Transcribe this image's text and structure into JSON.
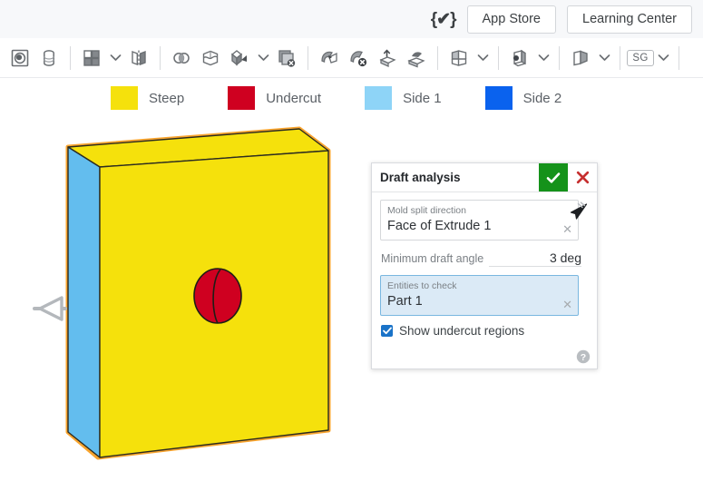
{
  "header": {
    "brace_icon": "{✔}",
    "buttons": [
      {
        "label": "App Store",
        "name": "app-store-button"
      },
      {
        "label": "Learning Center",
        "name": "learning-center-button"
      }
    ]
  },
  "toolbar": {
    "groups": [
      {
        "icons": [
          "sketch-icon",
          "cylinder-icon"
        ]
      },
      {
        "icons": [
          "pattern-icon"
        ],
        "caret": true
      },
      {
        "icons": [
          "mirror-icon"
        ]
      },
      {
        "icons": [
          "boolean-icon",
          "split-icon",
          "transform-icon"
        ],
        "caret_after": "transform-icon"
      },
      {
        "icons": [
          "delete-face-icon"
        ]
      },
      {
        "icons": [
          "draft-icon",
          "delete-part-icon",
          "move-face-icon",
          "shell-icon"
        ]
      },
      {
        "icons": [
          "section-view-icon"
        ],
        "caret": true
      },
      {
        "icons": [
          "measure-icon"
        ],
        "caret": true
      },
      {
        "icons": [
          "draft-analysis-icon"
        ],
        "caret": true
      },
      {
        "icons": [
          "sg-icon"
        ],
        "caret": true,
        "sg_label": "SG"
      }
    ]
  },
  "legend": {
    "items": [
      {
        "label": "Steep",
        "color": "#f5e10c",
        "name": "legend-steep"
      },
      {
        "label": "Undercut",
        "color": "#cf0020",
        "name": "legend-undercut"
      },
      {
        "label": "Side 1",
        "color": "#8ed4f7",
        "name": "legend-side-1"
      },
      {
        "label": "Side 2",
        "color": "#0a62ee",
        "name": "legend-side-2"
      }
    ]
  },
  "viewport": {
    "model": {
      "name": "draft-analysis-part",
      "front_face_color": "#f5e10c",
      "side_face_color": "#63bdee",
      "top_face_color": "#f5e10c",
      "hole_color": "#cf0020",
      "highlight_edge_color": "#f8a42e",
      "edge_color": "#2b2b20",
      "arrow_color": "#b4b8bc",
      "arrow_label": "mold-split-direction-arrow"
    }
  },
  "dialog": {
    "title": "Draft analysis",
    "accept_label": "✓",
    "cancel_label": "✕",
    "accept_color": "#15921a",
    "cancel_color": "#c62f2f",
    "mold_split": {
      "label": "Mold split direction",
      "value": "Face of Extrude 1",
      "clear": "✕"
    },
    "picker_icon": "flip-direction-icon",
    "angle": {
      "label": "Minimum draft angle",
      "value": "3 deg"
    },
    "entities": {
      "label": "Entities to check",
      "value": "Part 1",
      "clear": "✕"
    },
    "checkbox": {
      "label": "Show undercut regions",
      "checked": true
    },
    "help_icon": "help-icon"
  }
}
